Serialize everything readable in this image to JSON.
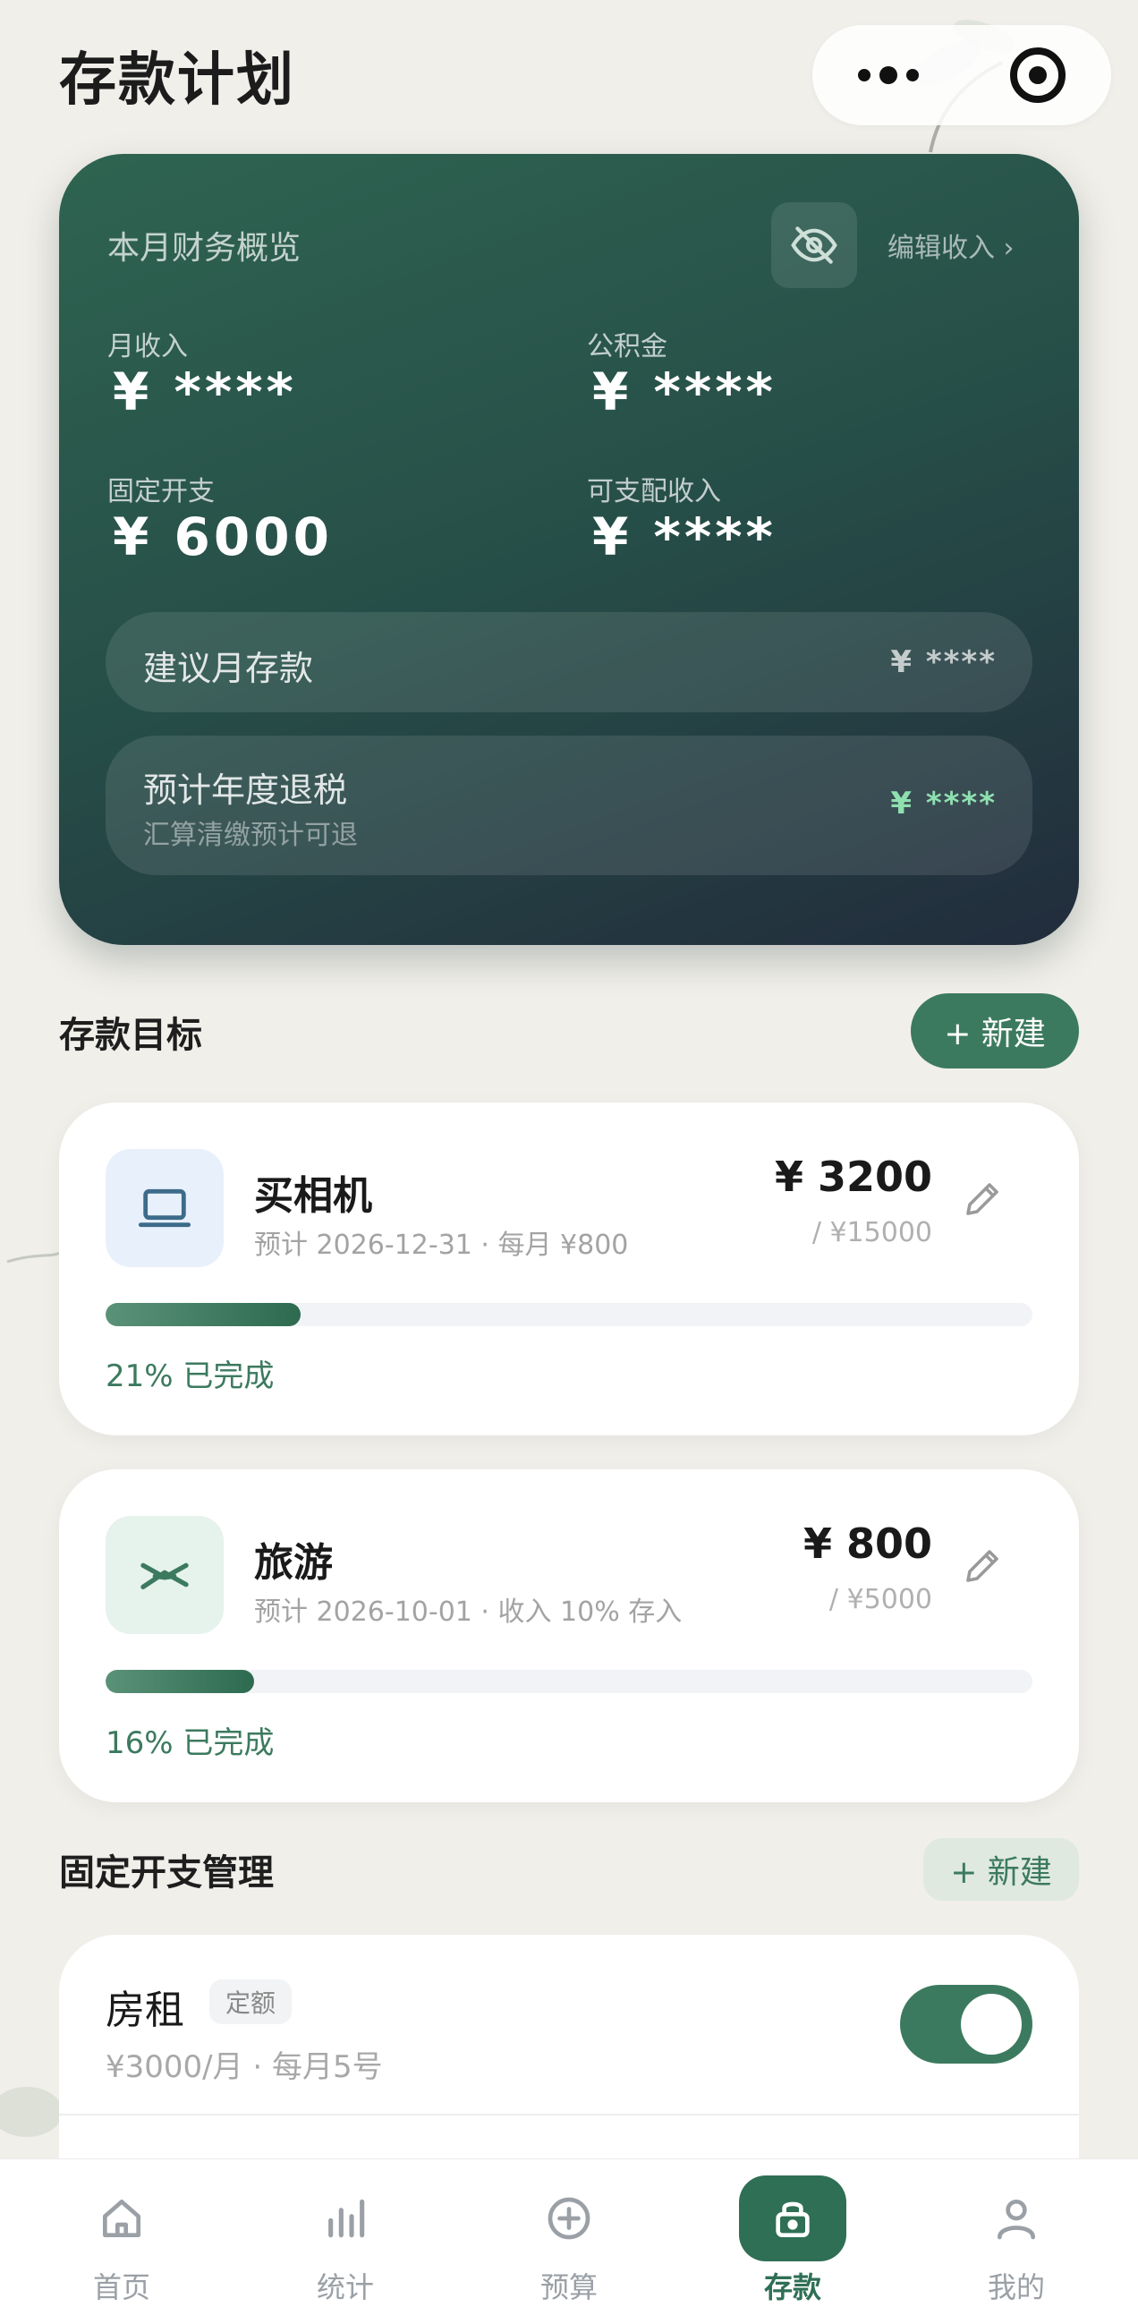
{
  "header": {
    "title": "存款计划"
  },
  "overview": {
    "title": "本月财务概览",
    "edit_income": "编辑收入 ›",
    "monthly_income": {
      "label": "月收入",
      "value": "¥ ****"
    },
    "provident_fund": {
      "label": "公积金",
      "value": "¥ ****"
    },
    "fixed_expense": {
      "label": "固定开支",
      "value": "¥ 6000"
    },
    "disposable_income": {
      "label": "可支配收入",
      "value": "¥ ****"
    },
    "suggested_saving": {
      "label": "建议月存款",
      "value": "¥ ****"
    },
    "tax_refund": {
      "label": "预计年度退税",
      "sub": "汇算清缴预计可退",
      "value": "¥ ****"
    }
  },
  "goals_section": {
    "title": "存款目标",
    "new_label": "+ 新建",
    "items": [
      {
        "name": "买相机",
        "sub": "预计 2026-12-31 · 每月 ¥800",
        "amount": "¥ 3200",
        "total": "/ ¥15000",
        "percent_text": "21% 已完成",
        "progress": 0.21,
        "icon": "laptop-icon",
        "icon_bg": "#e8f0fb",
        "icon_color": "#3d6b8a"
      },
      {
        "name": "旅游",
        "sub": "预计 2026-10-01 · 收入 10% 存入",
        "amount": "¥ 800",
        "total": "/ ¥5000",
        "percent_text": "16% 已完成",
        "progress": 0.16,
        "icon": "plane-icon",
        "icon_bg": "#e6f2ec",
        "icon_color": "#3c7a5f"
      }
    ]
  },
  "fixed_section": {
    "title": "固定开支管理",
    "new_label": "+ 新建",
    "items": [
      {
        "name": "房租",
        "tag": "定额",
        "sub": "¥3000/月 · 每月5号",
        "enabled": true
      }
    ]
  },
  "tabbar": {
    "items": [
      {
        "label": "首页",
        "icon": "home-icon"
      },
      {
        "label": "统计",
        "icon": "bar-chart-icon"
      },
      {
        "label": "预算",
        "icon": "plus-circle-icon"
      },
      {
        "label": "存款",
        "icon": "lock-icon",
        "active": true
      },
      {
        "label": "我的",
        "icon": "user-icon"
      }
    ]
  },
  "colors": {
    "accent": "#3c7a5f",
    "card_dark": "#264e48",
    "mint_value": "#8fe0b0"
  }
}
